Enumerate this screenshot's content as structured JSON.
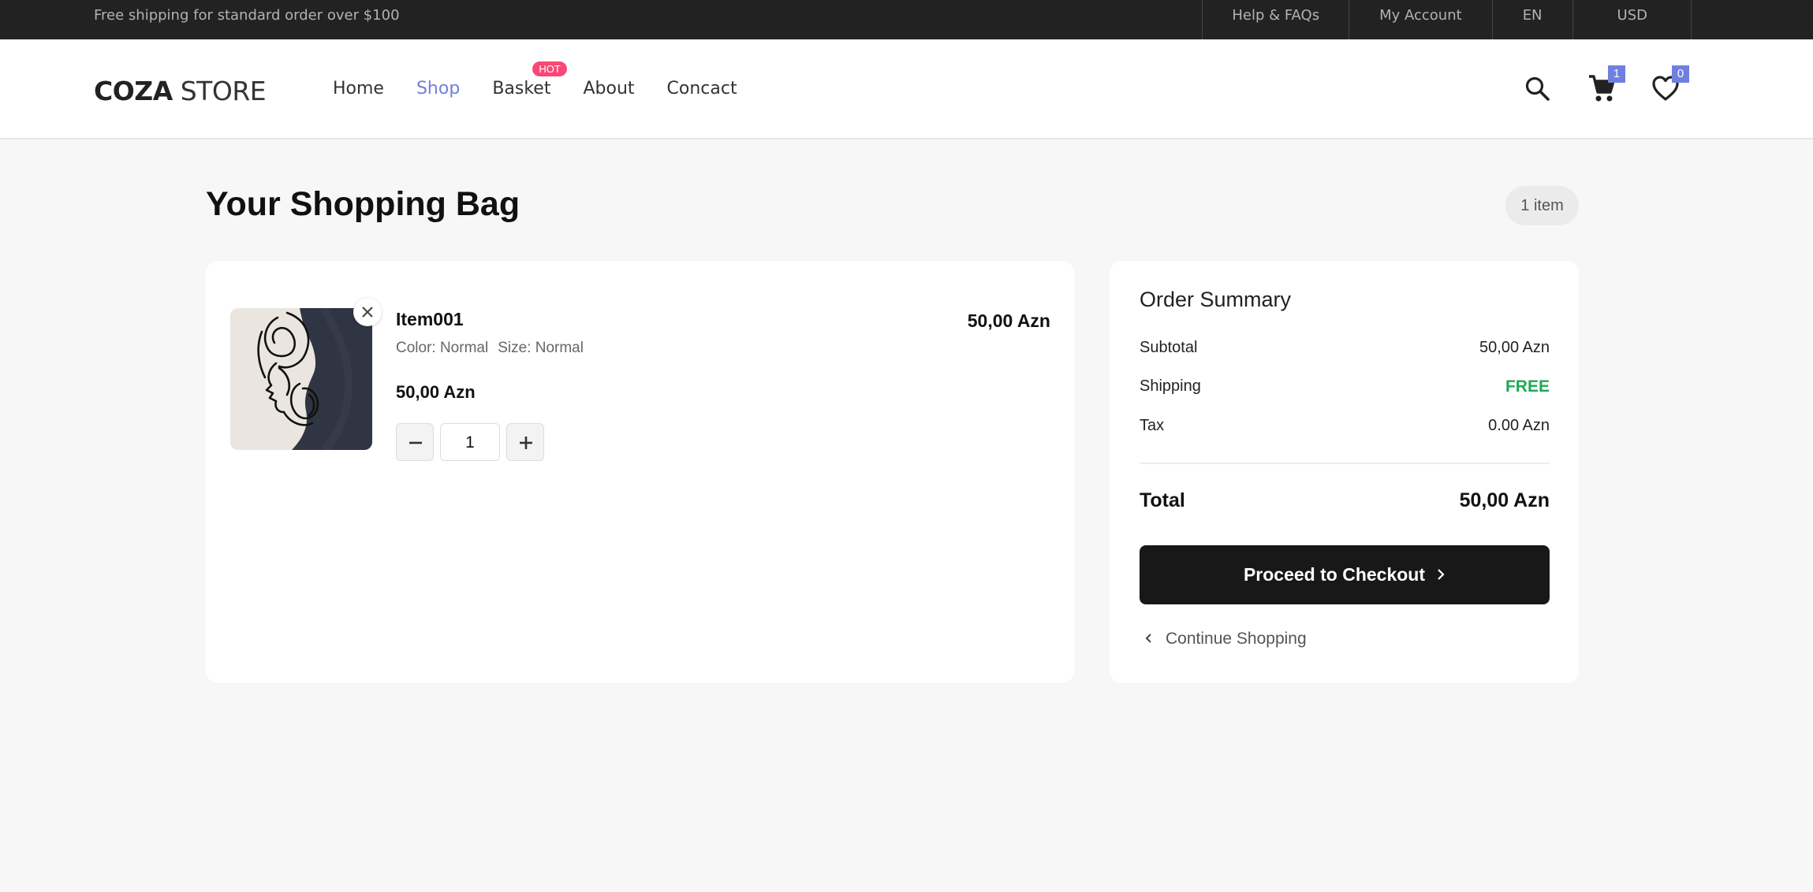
{
  "topbar": {
    "promo": "Free shipping for standard order over $100",
    "links": [
      "Help & FAQs",
      "My Account",
      "EN",
      "USD"
    ]
  },
  "header": {
    "logo_bold": "COZA",
    "logo_light": " STORE",
    "nav": [
      {
        "label": "Home"
      },
      {
        "label": "Shop"
      },
      {
        "label": "Basket",
        "badge": "HOT"
      },
      {
        "label": "About"
      },
      {
        "label": "Concact"
      }
    ],
    "active_nav": "Shop",
    "cart_count": "1",
    "wishlist_count": "0",
    "icons": [
      "search-icon",
      "cart-icon",
      "heart-icon"
    ]
  },
  "page": {
    "title": "Your Shopping Bag",
    "item_count": "1 item"
  },
  "cart": {
    "items": [
      {
        "name": "Item001",
        "color": "Color: Normal",
        "size": "Size: Normal",
        "price": "50,00 Azn",
        "line_total": "50,00 Azn",
        "quantity": "1"
      }
    ]
  },
  "summary": {
    "title": "Order Summary",
    "subtotal_label": "Subtotal",
    "subtotal_value": "50,00 Azn",
    "shipping_label": "Shipping",
    "shipping_value": "FREE",
    "tax_label": "Tax",
    "tax_value": "0.00 Azn",
    "total_label": "Total",
    "total_value": "50,00 Azn",
    "checkout_label": "Proceed to Checkout",
    "continue_label": "Continue Shopping"
  },
  "colors": {
    "accent": "#717fe0",
    "hot_badge": "#f74877",
    "free_green": "#1fa855",
    "topbar_bg": "#222222",
    "checkout_bg": "#181818"
  }
}
